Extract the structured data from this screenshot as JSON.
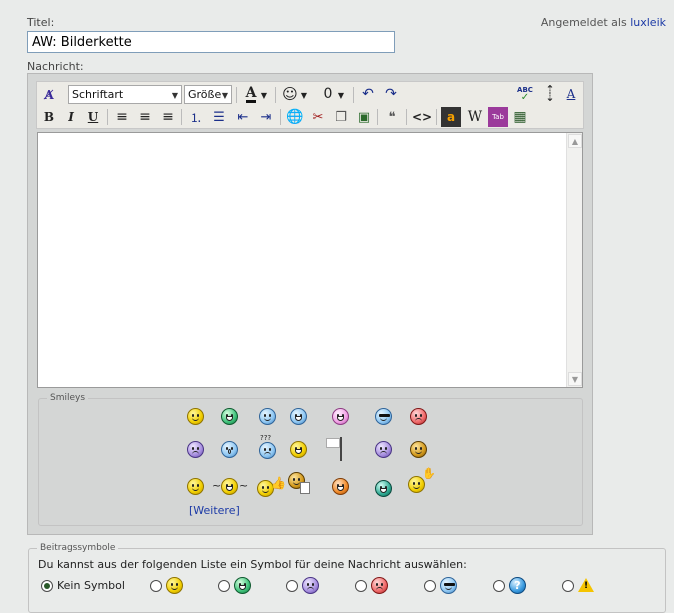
{
  "form": {
    "title_label": "Titel:",
    "title_value": "AW: Bilderkette",
    "message_label": "Nachricht:"
  },
  "login": {
    "prefix": "Angemeldet als",
    "username": "luxleik"
  },
  "toolbar": {
    "font_select": "Schriftart",
    "size_select": "Größe",
    "text_color_glyph": "A",
    "bold": "B",
    "italic": "I",
    "underline": "U",
    "wiki": "W",
    "code": "<>",
    "spell_label": "ABC",
    "table_label": "Tab",
    "font_size_glyph": "A"
  },
  "smileys": {
    "legend": "Smileys",
    "more_link": "[Weitere]",
    "row1": [
      {
        "color": "yellow",
        "mood": "smile"
      },
      {
        "color": "green",
        "mood": "grin"
      },
      {
        "color": "blue",
        "mood": "smile"
      },
      {
        "color": "blue",
        "mood": "grin"
      },
      {
        "color": "pink",
        "mood": "grin"
      },
      {
        "color": "blue",
        "mood": "cool"
      },
      {
        "color": "red",
        "mood": "sad"
      }
    ],
    "row2": [
      {
        "color": "purple",
        "mood": "sad"
      },
      {
        "color": "blue",
        "mood": "shock"
      },
      {
        "color": "blue",
        "mood": "confused",
        "label": "???"
      },
      {
        "color": "yellow",
        "mood": "grin"
      },
      {
        "color": "flag",
        "mood": "white-flag"
      },
      {
        "color": "purple",
        "mood": "cry"
      },
      {
        "color": "brown",
        "mood": "smile"
      }
    ],
    "row3": [
      {
        "color": "yellow",
        "mood": "smile"
      },
      {
        "color": "yellow",
        "mood": "cheer"
      },
      {
        "color": "yellow",
        "mood": "thumbs-up"
      },
      {
        "color": "brown",
        "mood": "reading"
      },
      {
        "color": "orange",
        "mood": "grin"
      },
      {
        "color": "teal",
        "mood": "grin"
      },
      {
        "color": "yellow",
        "mood": "wave"
      }
    ]
  },
  "post_icons": {
    "legend": "Beitragssymbole",
    "hint": "Du kannst aus der folgenden Liste ein Symbol für deine Nachricht auswählen:",
    "none_label": "Kein Symbol",
    "selected": "none",
    "options": [
      {
        "name": "smile",
        "color": "yellow"
      },
      {
        "name": "grin",
        "color": "green"
      },
      {
        "name": "sad",
        "color": "purple"
      },
      {
        "name": "angry",
        "color": "red"
      },
      {
        "name": "cool",
        "color": "blue"
      },
      {
        "name": "question",
        "color": "blue",
        "glyph": "?"
      },
      {
        "name": "warning",
        "color": "yellow",
        "glyph": "!"
      }
    ]
  },
  "colors": {
    "link": "#1c3aa6",
    "page_bg": "#e9ebea",
    "editor_bg": "#d4d6d5"
  }
}
